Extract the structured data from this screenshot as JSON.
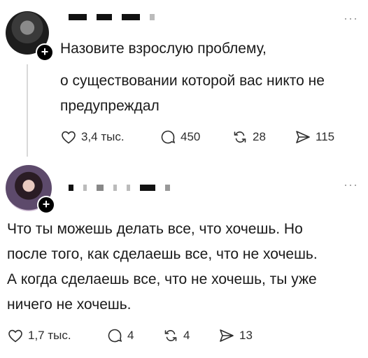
{
  "posts": [
    {
      "title": "Назовите взрослую проблему,",
      "body": "о существовании которой вас никто не\nпредупреждал",
      "stats": {
        "likes": "3,4 тыс.",
        "comments": "450",
        "reposts": "28",
        "shares": "115"
      }
    },
    {
      "body": "Что ты можешь делать все, что хочешь. Но\nпосле того, как сделаешь все, что не хочешь.\nА когда сделаешь все, что не хочешь, ты уже\nничего не хочешь.",
      "stats": {
        "likes": "1,7 тыс.",
        "comments": "4",
        "reposts": "4",
        "shares": "13"
      }
    }
  ],
  "ui": {
    "more": "···",
    "plus": "+"
  },
  "icons": [
    "heart-icon",
    "comment-icon",
    "repost-icon",
    "share-icon",
    "plus-icon",
    "more-icon"
  ]
}
